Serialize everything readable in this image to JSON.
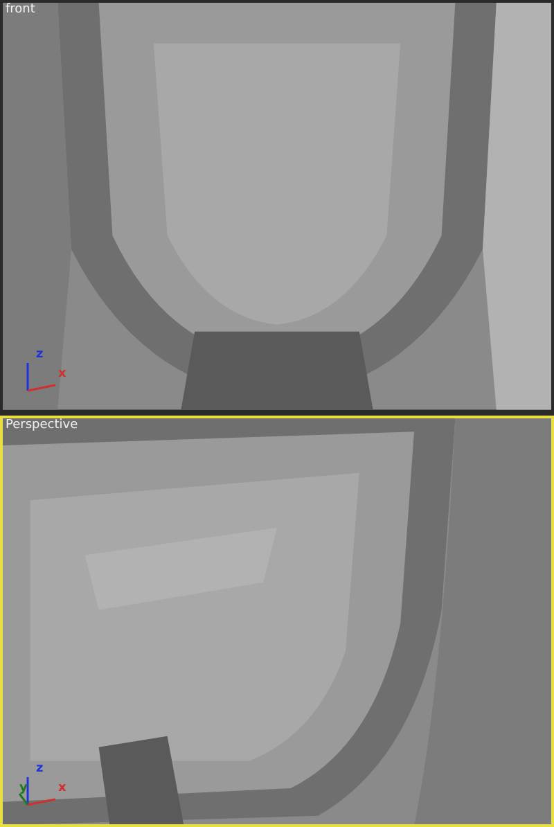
{
  "viewports": [
    {
      "label": "front",
      "active": false,
      "axes": [
        {
          "letter": "z",
          "kind": "up"
        },
        {
          "letter": "x",
          "kind": "right"
        }
      ]
    },
    {
      "label": "Perspective",
      "active": true,
      "axes": [
        {
          "letter": "z",
          "kind": "up"
        },
        {
          "letter": "y",
          "kind": "depth"
        },
        {
          "letter": "x",
          "kind": "right"
        }
      ]
    }
  ]
}
